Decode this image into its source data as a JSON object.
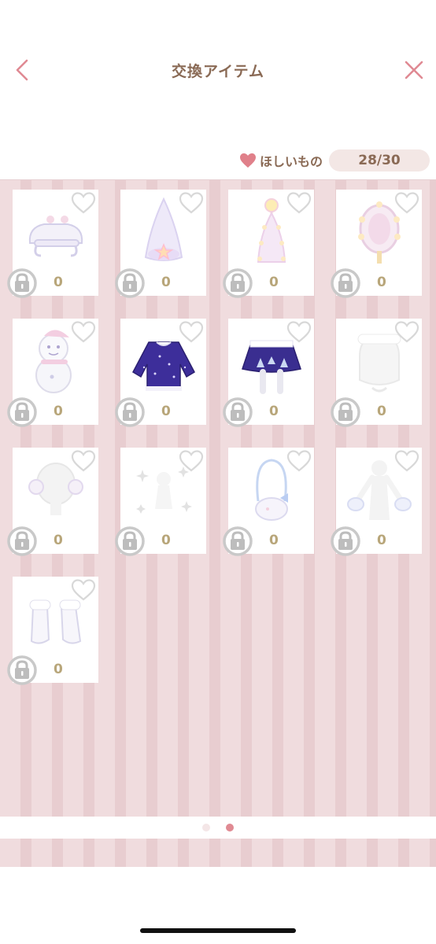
{
  "header": {
    "title": "交換アイテム",
    "back_icon": "chevron-left-icon",
    "close_icon": "close-icon",
    "accent_color": "#e08a93"
  },
  "wishlist": {
    "label": "ほしいもの",
    "count": "28/30",
    "heart_color": "#e0808a"
  },
  "items": [
    {
      "name": "snow-bench",
      "count": "0",
      "locked": true,
      "favorited": false
    },
    {
      "name": "star-cone-tree",
      "count": "0",
      "locked": true,
      "favorited": false
    },
    {
      "name": "star-lamp",
      "count": "0",
      "locked": true,
      "favorited": false
    },
    {
      "name": "light-mirror",
      "count": "0",
      "locked": true,
      "favorited": false
    },
    {
      "name": "snowman",
      "count": "0",
      "locked": true,
      "favorited": false
    },
    {
      "name": "night-sweater",
      "count": "0",
      "locked": true,
      "favorited": false
    },
    {
      "name": "tree-skirt",
      "count": "0",
      "locked": true,
      "favorited": false
    },
    {
      "name": "snow-hat",
      "count": "0",
      "locked": true,
      "favorited": false
    },
    {
      "name": "earmuffs",
      "count": "0",
      "locked": true,
      "favorited": false
    },
    {
      "name": "sparkle-effect",
      "count": "0",
      "locked": true,
      "favorited": false
    },
    {
      "name": "bunny-bag",
      "count": "0",
      "locked": true,
      "favorited": false
    },
    {
      "name": "fluffy-mittens",
      "count": "0",
      "locked": true,
      "favorited": false
    },
    {
      "name": "snow-boots",
      "count": "0",
      "locked": true,
      "favorited": false
    }
  ],
  "pager": {
    "pages": 2,
    "current": 2
  }
}
